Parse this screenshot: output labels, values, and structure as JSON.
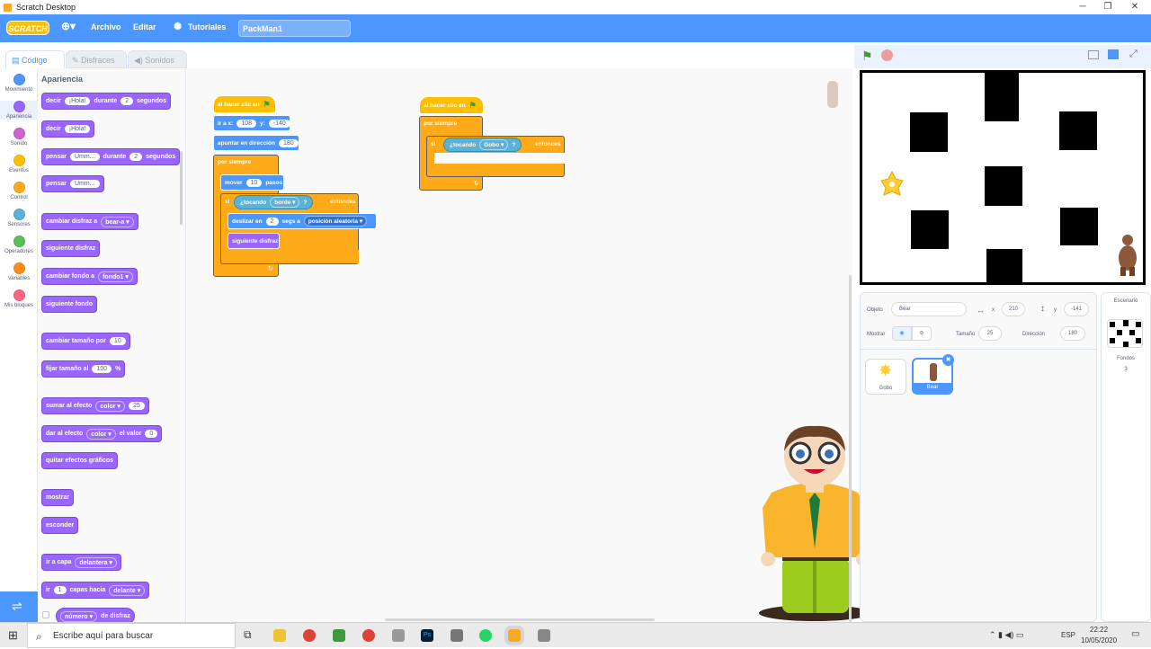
{
  "window": {
    "title": "Scratch Desktop",
    "minimize": "─",
    "maximize": "❐",
    "close": "✕"
  },
  "menubar": {
    "logo": "SCRATCH",
    "language_icon": "globe-icon",
    "file": "Archivo",
    "edit": "Editar",
    "tutorials": "Tutoriales",
    "project_title": "PackMan1"
  },
  "tabs": {
    "code": "Código",
    "costumes": "Disfraces",
    "sounds": "Sonidos"
  },
  "categories": [
    {
      "label": "Movimiento",
      "color": "#4c97ff"
    },
    {
      "label": "Apariencia",
      "color": "#9966ff"
    },
    {
      "label": "Sonido",
      "color": "#cf63cf"
    },
    {
      "label": "Eventos",
      "color": "#ffbf00"
    },
    {
      "label": "Control",
      "color": "#ffab19"
    },
    {
      "label": "Sensores",
      "color": "#5cb1d6"
    },
    {
      "label": "Operadores",
      "color": "#59c059"
    },
    {
      "label": "Variables",
      "color": "#ff8c1a"
    },
    {
      "label": "Mis bloques",
      "color": "#ff6680"
    }
  ],
  "palette": {
    "heading": "Apariencia",
    "blocks": {
      "say_for": {
        "a": "decir",
        "v1": "¡Hola!",
        "b": "durante",
        "v2": "2",
        "c": "segundos"
      },
      "say": {
        "a": "decir",
        "v1": "¡Hola!"
      },
      "think_for": {
        "a": "pensar",
        "v1": "Umm...",
        "b": "durante",
        "v2": "2",
        "c": "segundos"
      },
      "think": {
        "a": "pensar",
        "v1": "Umm..."
      },
      "switch_costume": {
        "a": "cambiar disfraz a",
        "v1": "bear-a ▾"
      },
      "next_costume": {
        "a": "siguiente disfraz"
      },
      "switch_backdrop": {
        "a": "cambiar fondo a",
        "v1": "fondo1 ▾"
      },
      "next_backdrop": {
        "a": "siguiente fondo"
      },
      "change_size": {
        "a": "cambiar tamaño por",
        "v1": "10"
      },
      "set_size": {
        "a": "fijar tamaño al",
        "v1": "100",
        "b": "%"
      },
      "change_effect": {
        "a": "sumar al efecto",
        "v1": "color ▾",
        "b": "25"
      },
      "set_effect": {
        "a": "dar al efecto",
        "v1": "color ▾",
        "b": "el valor",
        "v2": "0"
      },
      "clear_effects": {
        "a": "quitar efectos gráficos"
      },
      "show": {
        "a": "mostrar"
      },
      "hide": {
        "a": "esconder"
      },
      "go_layer": {
        "a": "ir a capa",
        "v1": "delantera ▾"
      },
      "go_layers": {
        "a": "ir",
        "v1": "1",
        "b": "capas hacia",
        "v2": "delante ▾"
      },
      "costume_num": {
        "a": "número ▾",
        "b": "de disfraz"
      }
    }
  },
  "scripts": {
    "s1": {
      "hat": "al hacer clic en",
      "goto": {
        "a": "ir a x:",
        "x": "108",
        "b": "y:",
        "y": "-140"
      },
      "point": {
        "a": "apuntar en dirección",
        "v": "180"
      },
      "forever": "por siempre",
      "move": {
        "a": "mover",
        "v": "10",
        "b": "pasos"
      },
      "if": {
        "a": "si",
        "cond": "¿tocando",
        "target": "borde ▾",
        "q": "?",
        "then": "entonces"
      },
      "glide": {
        "a": "deslizar en",
        "v": "2",
        "b": "segs a",
        "target": "posición aleatoria ▾"
      },
      "next": "siguiente disfraz",
      "loop_arrow": "↻"
    },
    "s2": {
      "hat": "al hacer clic en",
      "forever": "por siempre",
      "if": {
        "a": "si",
        "cond": "¿tocando",
        "target": "Gobo ▾",
        "q": "?",
        "then": "entonces"
      },
      "loop_arrow": "↻"
    }
  },
  "stage_controls": {
    "green_flag": "green-flag-icon",
    "stop": "stop-icon"
  },
  "sprite_info": {
    "object_label": "Objeto",
    "object_name": "Bear",
    "x_label": "x",
    "x": "210",
    "y_label": "y",
    "y": "-141",
    "show_label": "Mostrar",
    "size_label": "Tamaño",
    "size": "25",
    "direction_label": "Dirección",
    "direction": "180"
  },
  "sprites": [
    {
      "name": "Gobo",
      "selected": false
    },
    {
      "name": "Bear",
      "selected": true
    }
  ],
  "backdrop": {
    "heading": "Escenario",
    "label": "Fondos",
    "count": "3"
  },
  "taskbar": {
    "search_placeholder": "Escribe aquí para buscar",
    "language": "ESP",
    "time": "22:22",
    "date": "10/05/2020"
  }
}
